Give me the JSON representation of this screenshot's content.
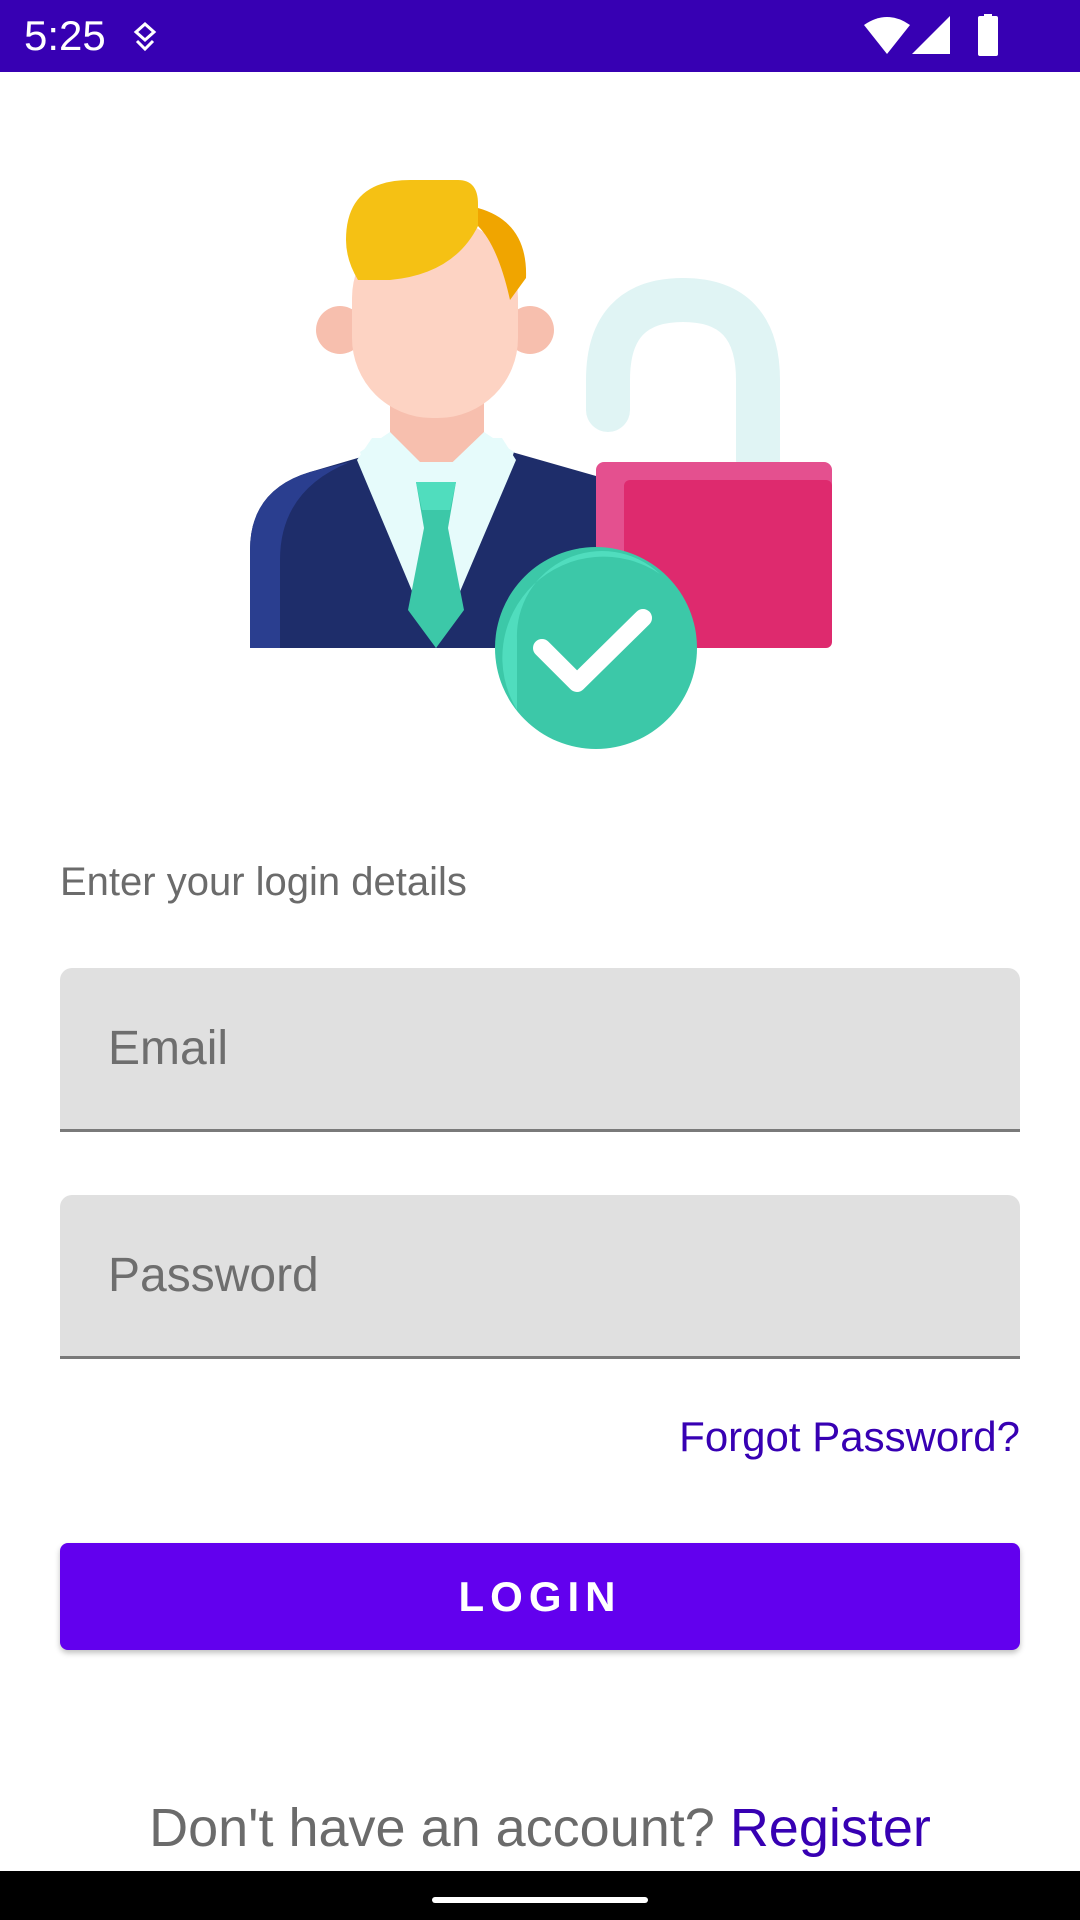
{
  "status_bar": {
    "time": "5:25",
    "background": "#3700B3",
    "icons": [
      "download-indicator-icon",
      "wifi-icon",
      "cell-signal-icon",
      "battery-icon"
    ]
  },
  "illustration": {
    "icon": "user-unlock-success-icon"
  },
  "login_form": {
    "prompt": "Enter your login details",
    "email": {
      "placeholder": "Email",
      "value": ""
    },
    "password": {
      "placeholder": "Password",
      "value": ""
    },
    "forgot_password": "Forgot Password?",
    "login_button": "LOGIN"
  },
  "register": {
    "prompt": "Don't have an account? ",
    "link": "Register"
  },
  "colors": {
    "primary": "#6200EE",
    "primary_dark": "#3700B3",
    "field_background": "#E0E0E0",
    "secondary_text": "#6B6B6B"
  }
}
